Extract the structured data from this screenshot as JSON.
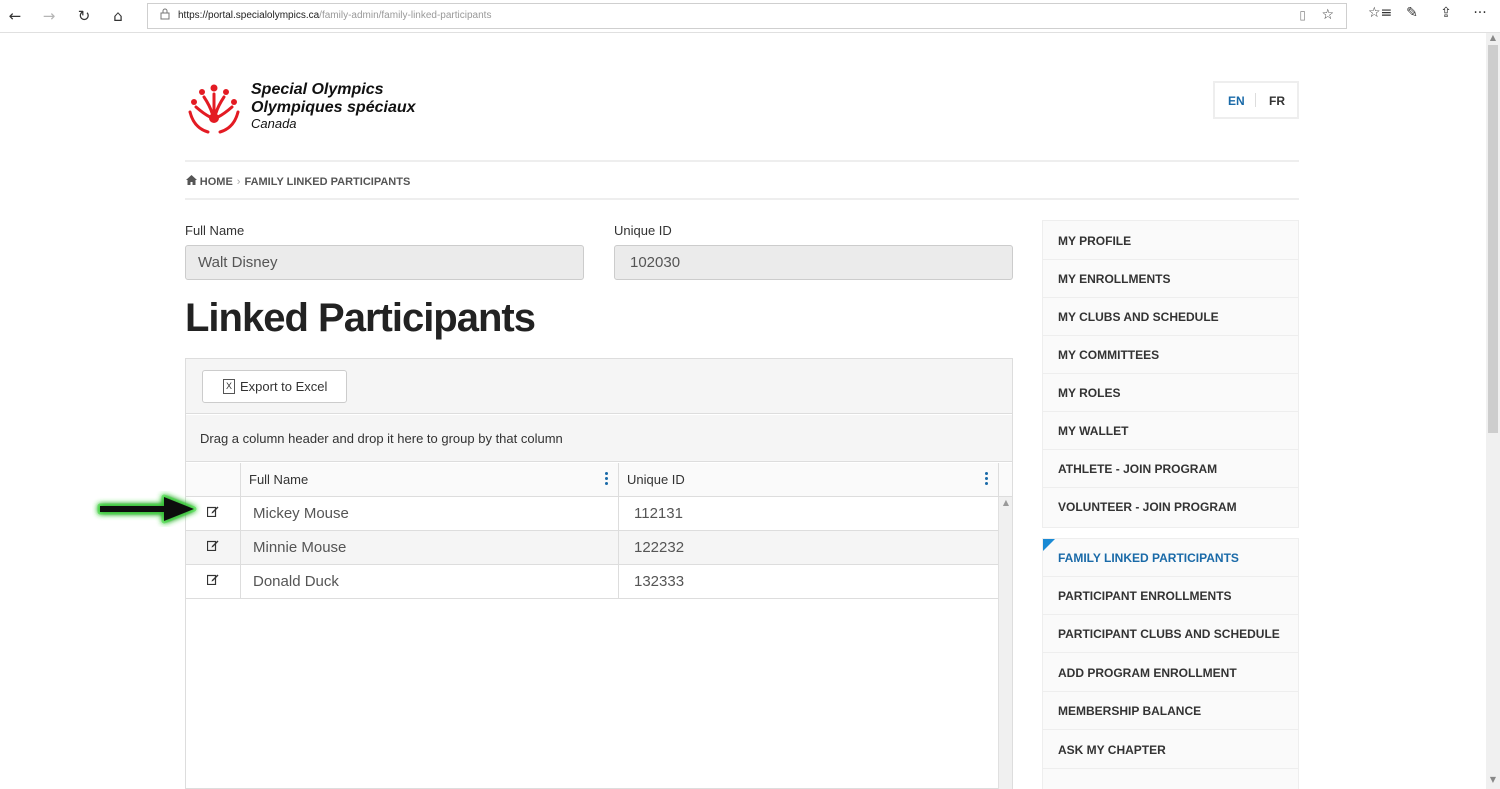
{
  "browser": {
    "url_host": "https://portal.specialolympics.ca",
    "url_path": "/family-admin/family-linked-participants",
    "back_icon": "←",
    "forward_icon": "→",
    "refresh_icon": "↻",
    "home_icon": "⌂",
    "lock_icon": "🔒",
    "reading_icon": "▯",
    "favorite_icon": "☆",
    "favorites_list_icon": "☆≡",
    "pen_icon": "✎",
    "share_icon": "⇪",
    "more_icon": "···"
  },
  "header": {
    "logo_line1": "Special Olympics",
    "logo_line2": "Olympiques spéciaux",
    "logo_line3": "Canada",
    "lang_en": "EN",
    "lang_fr": "FR",
    "accent_color": "#1a6aa8",
    "logo_color": "#e31b23"
  },
  "breadcrumb": {
    "home": "HOME",
    "sep": "›",
    "current": "FAMILY LINKED PARTICIPANTS"
  },
  "form": {
    "full_name_label": "Full Name",
    "full_name_value": "Walt Disney",
    "unique_id_label": "Unique ID",
    "unique_id_value": "102030"
  },
  "page_title": "Linked Participants",
  "grid": {
    "export_label": "Export to Excel",
    "export_icon": "X",
    "group_hint": "Drag a column header and drop it here to group by that column",
    "columns": [
      "Full Name",
      "Unique ID"
    ],
    "edit_icon": "✎",
    "rows": [
      {
        "name": "Mickey Mouse",
        "id": "112131"
      },
      {
        "name": "Minnie Mouse",
        "id": "122232"
      },
      {
        "name": "Donald Duck",
        "id": "132333"
      }
    ]
  },
  "sidebar": {
    "group1": [
      "MY PROFILE",
      "MY ENROLLMENTS",
      "MY CLUBS AND SCHEDULE",
      "MY COMMITTEES",
      "MY ROLES",
      "MY WALLET",
      "ATHLETE - JOIN PROGRAM",
      "VOLUNTEER - JOIN PROGRAM"
    ],
    "group2": [
      "FAMILY LINKED PARTICIPANTS",
      "PARTICIPANT ENROLLMENTS",
      "PARTICIPANT CLUBS AND SCHEDULE",
      "ADD PROGRAM ENROLLMENT",
      "MEMBERSHIP BALANCE",
      "ASK MY CHAPTER"
    ]
  },
  "annotation": {
    "arrow_color": "#111111",
    "glow_color": "#3ee03e"
  }
}
